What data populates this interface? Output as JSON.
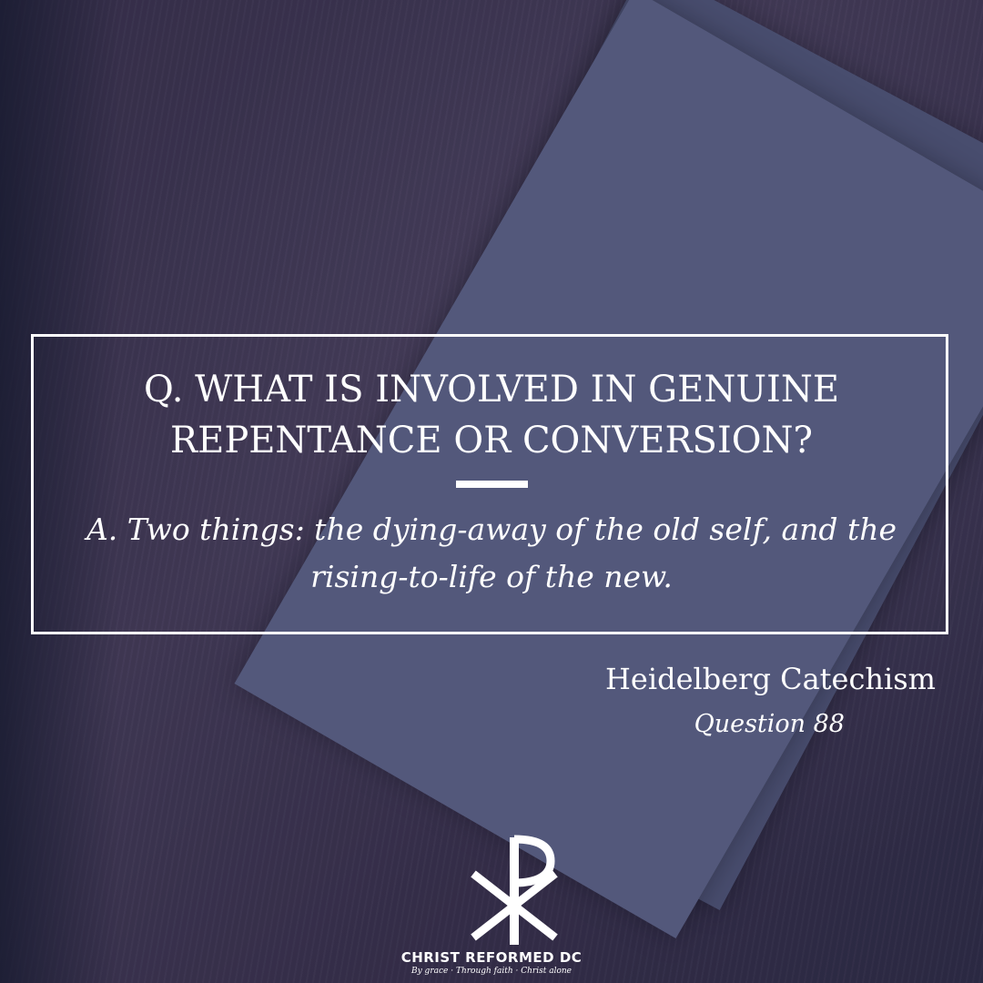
{
  "question": "Q. What is involved in genuine repentance or conversion?",
  "answer": "A. Two things: the dying-away of the old self, and the rising-to-life of the new.",
  "source": {
    "title": "Heidelberg Catechism",
    "subtitle": "Question 88"
  },
  "brand": {
    "name": "CHRIST REFORMED DC",
    "tagline": "By grace · Through faith · Christ alone",
    "logo_icon": "chi-rho-icon"
  },
  "colors": {
    "overlay": "#3b3a5a",
    "text": "#ffffff"
  }
}
